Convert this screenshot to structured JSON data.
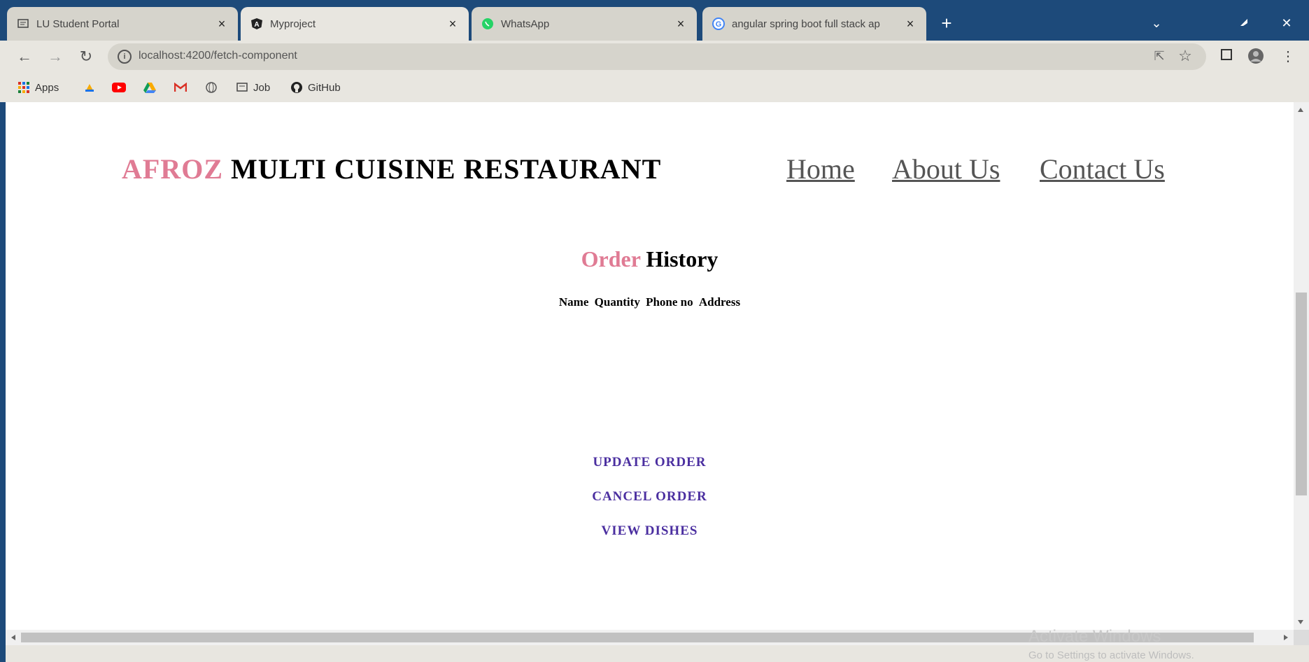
{
  "browser": {
    "tabs": [
      {
        "title": "LU Student Portal",
        "icon": "portal-icon"
      },
      {
        "title": "Myproject",
        "icon": "angular-icon"
      },
      {
        "title": "WhatsApp",
        "icon": "whatsapp-icon"
      },
      {
        "title": "angular spring boot full stack ap",
        "icon": "google-icon"
      }
    ],
    "url": "localhost:4200/fetch-component",
    "bookmarks": [
      {
        "label": "Apps",
        "icon": "apps-grid-icon"
      },
      {
        "label": "",
        "icon": "drive-like-icon"
      },
      {
        "label": "",
        "icon": "youtube-icon"
      },
      {
        "label": "",
        "icon": "google-drive-icon"
      },
      {
        "label": "",
        "icon": "gmail-icon"
      },
      {
        "label": "",
        "icon": "globe-icon"
      },
      {
        "label": "Job",
        "icon": "portal-icon"
      },
      {
        "label": "GitHub",
        "icon": "github-icon"
      }
    ]
  },
  "site": {
    "brand": "AFROZ",
    "title_rest": "MULTI CUISINE RESTAURANT",
    "nav": [
      "Home",
      "About Us",
      "Contact Us"
    ]
  },
  "order_history": {
    "title_accent": "Order",
    "title_rest": "History",
    "columns": [
      "Name",
      "Quantity",
      "Phone no",
      "Address"
    ],
    "actions": [
      "UPDATE ORDER",
      "CANCEL ORDER",
      "VIEW DISHES"
    ]
  },
  "os": {
    "watermark_title": "Activate Windows",
    "watermark_sub": "Go to Settings to activate Windows."
  },
  "colors": {
    "accent_pink": "#e07b94",
    "link_purple": "#4b2fa0",
    "chrome_blue": "#1d4a7a"
  }
}
